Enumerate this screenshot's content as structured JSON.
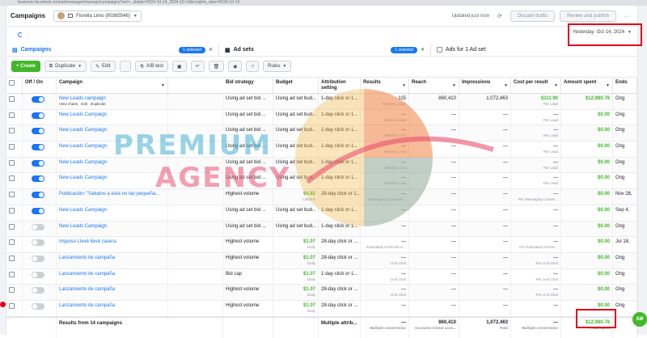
{
  "browser": {
    "url": "business.facebook.com/adsmanager/manage/campaigns?act=...&date=2024-10-14_2024-10-14&insights_date=2024-10-14"
  },
  "header": {
    "title": "Campaigns",
    "account_name": "Fiorella Limo (80365546)",
    "updated_text": "Updated just now",
    "discard_label": "Discard drafts",
    "review_label": "Review and publish",
    "more_label": "···"
  },
  "date_picker": {
    "value": "Yesterday: Oct 14, 2024"
  },
  "tabs": {
    "campaigns": {
      "label": "Campaigns",
      "pill": "1 selected"
    },
    "adsets": {
      "label": "Ad sets",
      "pill": "1 selected"
    },
    "ads": {
      "label": "Ads for 1 Ad set"
    }
  },
  "toolbar": {
    "create": "+ Create",
    "duplicate": "Duplicate",
    "edit": "Edit",
    "abtest": "A/B test",
    "rules": "Rules"
  },
  "columns": [
    "Off / On",
    "Campaign",
    "Bid strategy",
    "Budget",
    "Attribution setting",
    "Results",
    "Reach",
    "Impressions",
    "Cost per result",
    "Amount spent",
    "Ends"
  ],
  "rows": [
    {
      "on": true,
      "name": "New Leads campaign",
      "sub_actions": [
        "View charts",
        "Edit",
        "Duplicate"
      ],
      "bid": "Using ad set bid ...",
      "budget": "Using ad set bud...",
      "attr": "1-day click or 1...",
      "results": "115",
      "results_sub": "Website Leads",
      "reach": "860,410",
      "impr": "1,072,463",
      "cpr": "$111.90",
      "cpr_sub": "Per Lead",
      "spent": "$12,980.78",
      "ends": "Ong"
    },
    {
      "on": true,
      "name": "New Leads Campaign",
      "bid": "Using ad set bid ...",
      "budget": "Using ad set bud...",
      "attr": "1-day click or 1...",
      "results": "—",
      "results_sub": "Website Lead",
      "reach": "—",
      "impr": "—",
      "cpr": "—",
      "cpr_sub": "Per Lead",
      "spent": "$0.00",
      "ends": "Ong"
    },
    {
      "on": true,
      "name": "New Leads Campaign",
      "bid": "Using ad set bid ...",
      "budget": "Using ad set bud...",
      "attr": "1-day click or 1...",
      "results": "—",
      "results_sub": "Website Lead",
      "reach": "—",
      "impr": "—",
      "cpr": "—",
      "cpr_sub": "Per Lead",
      "spent": "$0.00",
      "ends": "Ong"
    },
    {
      "on": true,
      "name": "New Leads Campaign",
      "bid": "Using ad set bid ...",
      "budget": "Using ad set bud...",
      "attr": "1-day click or 1...",
      "results": "—",
      "results_sub": "Website Lead",
      "reach": "—",
      "impr": "—",
      "cpr": "—",
      "cpr_sub": "Per Lead",
      "spent": "$0.00",
      "ends": "Ong"
    },
    {
      "on": true,
      "name": "New Leads Campaign",
      "bid": "Using ad set bid ...",
      "budget": "Using ad set bud...",
      "attr": "1-day click or 1...",
      "results": "—",
      "results_sub": "Website Lead",
      "reach": "—",
      "impr": "—",
      "cpr": "—",
      "cpr_sub": "Per Lead",
      "spent": "$0.00",
      "ends": "Ong"
    },
    {
      "on": true,
      "name": "New Leads Campaign",
      "bid": "Using ad set bid ...",
      "budget": "Using ad set bud...",
      "attr": "1-day click or 1...",
      "results": "—",
      "results_sub": "Website Lead",
      "reach": "—",
      "impr": "—",
      "cpr": "—",
      "cpr_sub": "Per Lead",
      "spent": "$0.00",
      "ends": "Ong"
    },
    {
      "on": true,
      "name": "Publicación: \"Saludos a esta no tan pequeña...",
      "bid": "Highest volume",
      "budget": "$4.82",
      "budget_sub": "Lifetime",
      "attr": "28-day click or 1...",
      "results": "—",
      "results_sub": "Messaging Conversat...",
      "reach": "—",
      "impr": "—",
      "cpr": "—",
      "cpr_sub": "Per Messaging Conver...",
      "spent": "$0.00",
      "ends": "Nov 26,"
    },
    {
      "on": true,
      "name": "New Leads Campaign",
      "bid": "Using ad set bid ...",
      "budget": "Using ad set bud...",
      "attr": "1-day click or 1...",
      "results": "—",
      "results_sub": "",
      "reach": "—",
      "impr": "—",
      "cpr": "—",
      "cpr_sub": "",
      "spent": "$0.00",
      "ends": "Sep 4,"
    },
    {
      "on": false,
      "name": "New Leads Campaign",
      "bid": "Using ad set bid ...",
      "budget": "Using ad set bud...",
      "attr": "1-day click or 1...",
      "results": "—",
      "results_sub": "",
      "reach": "—",
      "impr": "—",
      "cpr": "—",
      "cpr_sub": "",
      "spent": "$0.00",
      "ends": "Ong"
    },
    {
      "on": false,
      "name": "Impulso Llevé llevé casera",
      "bid": "Highest volume",
      "budget": "$1.07",
      "budget_sub": "Daily",
      "attr": "28-day click or ...",
      "results": "—",
      "results_sub": "Estimated Ad Recall Li...",
      "reach": "—",
      "impr": "—",
      "cpr": "—",
      "cpr_sub": "Per Estimated Ad Rec...",
      "spent": "$0.00",
      "ends": "Jul 18,"
    },
    {
      "on": false,
      "name": "Lanzamiento de campaña",
      "bid": "Highest volume",
      "budget": "$1.07",
      "budget_sub": "Daily",
      "attr": "28-day click or ...",
      "results": "—",
      "results_sub": "Link Click",
      "reach": "—",
      "impr": "—",
      "cpr": "—",
      "cpr_sub": "Per Link Click",
      "spent": "$0.00",
      "ends": "Ong"
    },
    {
      "on": false,
      "name": "Lanzamiento de campaña",
      "bid": "Bid cap",
      "budget": "$1.07",
      "budget_sub": "Daily",
      "attr": "1-day click or 1...",
      "results": "—",
      "results_sub": "Link Click",
      "reach": "—",
      "impr": "—",
      "cpr": "—",
      "cpr_sub": "Per Link Click",
      "spent": "$0.00",
      "ends": "Ong"
    },
    {
      "on": false,
      "name": "Lanzamiento de campaña",
      "bid": "Highest volume",
      "budget": "$1.07",
      "budget_sub": "Daily",
      "attr": "28-day click or ...",
      "results": "—",
      "results_sub": "Link Click",
      "reach": "—",
      "impr": "—",
      "cpr": "—",
      "cpr_sub": "Per Link Click",
      "spent": "$0.00",
      "ends": "Ong"
    },
    {
      "on": false,
      "name": "Lanzamiento de campaña",
      "bid": "Highest volume",
      "budget": "$1.07",
      "budget_sub": "Daily",
      "attr": "28-day click or ...",
      "results": "—",
      "results_sub": "",
      "reach": "—",
      "impr": "—",
      "cpr": "—",
      "cpr_sub": "",
      "spent": "$0.00",
      "ends": "Ong"
    }
  ],
  "footer": {
    "label": "Results from 14 campaigns",
    "attr": "Multiple attrib...",
    "results": "—",
    "results_sub": "Multiple conversions",
    "reach": "860,410",
    "reach_sub": "Accounts Center acco...",
    "impr": "1,072,463",
    "impr_sub": "Total",
    "cpr": "—",
    "cpr_sub": "Multiple conversions",
    "spent": "$12,980.78",
    "spent_sub": "Total spent"
  },
  "watermark": {
    "line1": "PREMIUM",
    "line2": "AGENCY"
  },
  "corner_badge": "SM",
  "colors": {
    "brand_blue": "#1877f2",
    "green": "#42b72a",
    "highlight_red": "#e0001b"
  }
}
